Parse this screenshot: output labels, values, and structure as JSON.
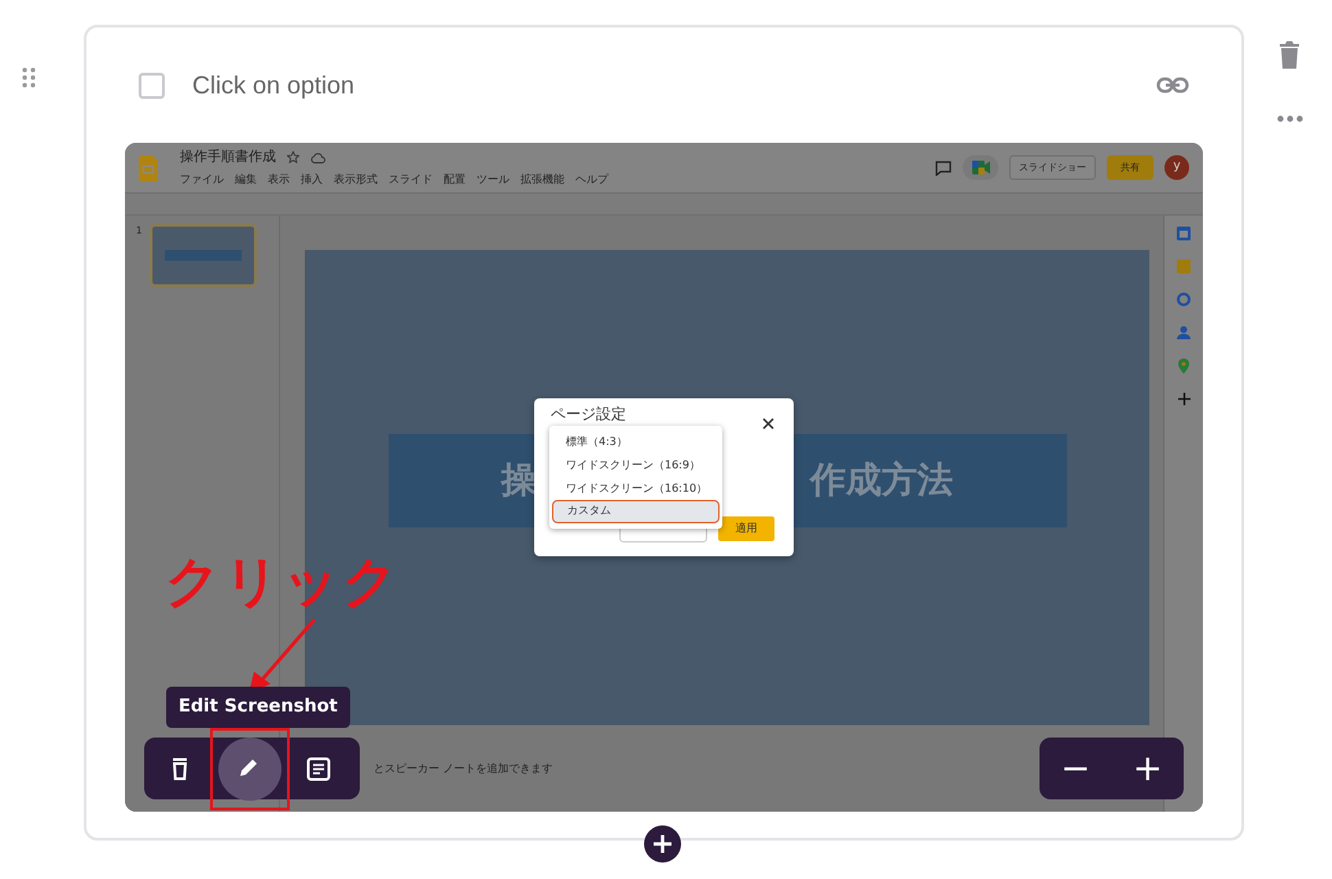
{
  "question": {
    "label": "Click on option",
    "checked": false
  },
  "screenshot": {
    "doc_title": "操作手順書作成",
    "menu": [
      "ファイル",
      "編集",
      "表示",
      "挿入",
      "表示形式",
      "スライド",
      "配置",
      "ツール",
      "拡張機能",
      "ヘルプ"
    ],
    "slideshow_button": "スライドショー",
    "share_button": "共有",
    "avatar": "y",
    "slide_number": "1",
    "slide_title_left": "操",
    "slide_title_right": "作成方法",
    "dialog": {
      "title": "ページ設定",
      "apply_button": "適用",
      "options": [
        {
          "label": "標準（4:3）",
          "selected": false
        },
        {
          "label": "ワイドスクリーン（16:9）",
          "selected": false
        },
        {
          "label": "ワイドスクリーン（16:10）",
          "selected": false
        },
        {
          "label": "カスタム",
          "selected": true
        }
      ]
    },
    "notes_text": "とスピーカー ノートを追加できます"
  },
  "annotation": {
    "text": "クリック"
  },
  "tooltip": "Edit Screenshot",
  "tools": [
    {
      "kind": "delete",
      "selected": false
    },
    {
      "kind": "edit",
      "selected": true
    },
    {
      "kind": "notes",
      "selected": false
    }
  ],
  "zoom": {
    "minus": "−",
    "plus": "+"
  }
}
